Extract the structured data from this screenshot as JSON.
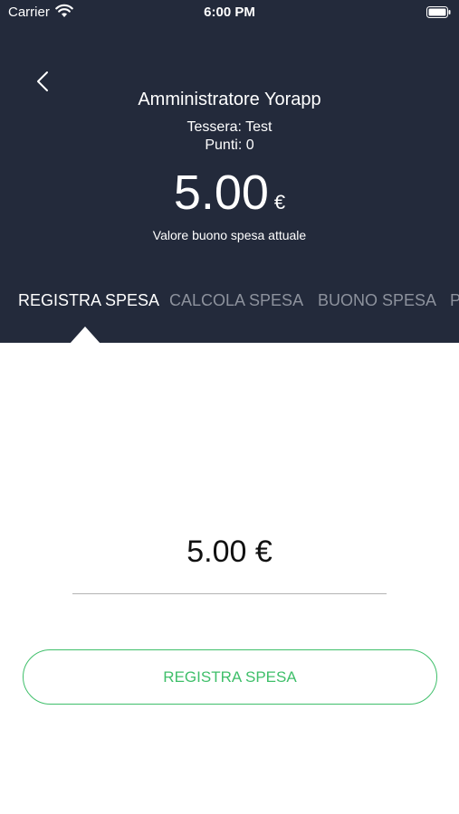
{
  "status_bar": {
    "carrier": "Carrier",
    "time": "6:00 PM"
  },
  "header": {
    "user_name": "Amministratore Yorapp",
    "card": "Tessera: Test",
    "points": "Punti: 0",
    "voucher_amount": "5.00",
    "voucher_currency": "€",
    "voucher_caption": "Valore buono spesa attuale"
  },
  "tabs": [
    {
      "label": "REGISTRA SPESA",
      "active": true
    },
    {
      "label": "CALCOLA SPESA",
      "active": false
    },
    {
      "label": "BUONO SPESA",
      "active": false
    },
    {
      "label": "P",
      "active": false
    }
  ],
  "form": {
    "amount": "5.00 €",
    "submit_label": "REGISTRA SPESA"
  },
  "colors": {
    "header_bg": "#232a3b",
    "accent_green": "#3fbf6a",
    "inactive_tab": "#8d929d"
  },
  "icons": [
    "wifi-icon",
    "battery-icon",
    "chevron-left-icon"
  ]
}
